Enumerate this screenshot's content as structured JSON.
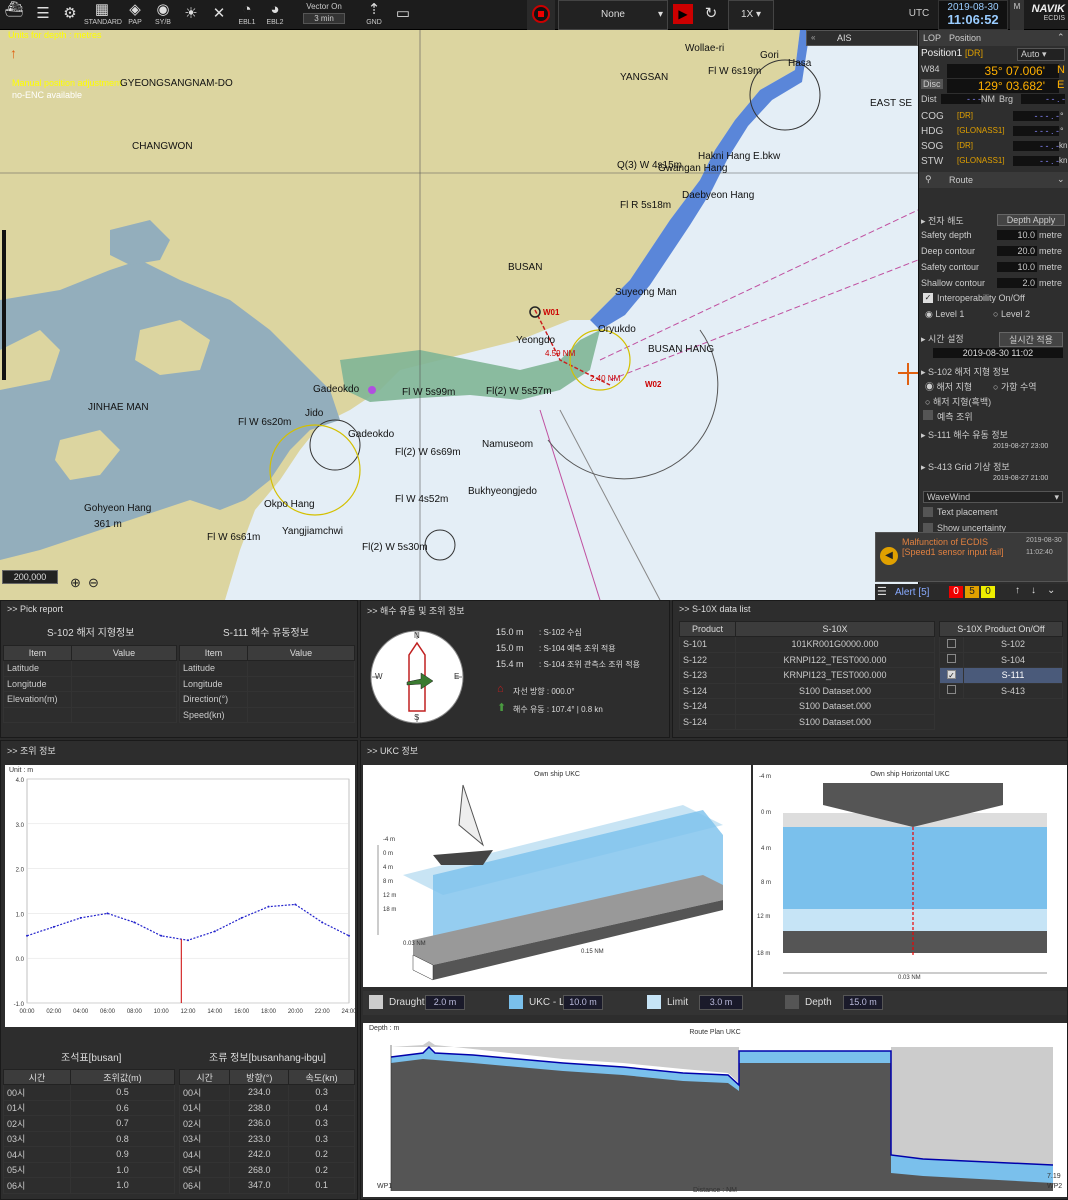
{
  "toolbar": {
    "standard": "STANDARD",
    "pap": "PAP",
    "syb": "SY/B",
    "ebl1": "EBL1",
    "ebl2": "EBL2",
    "vector_label": "Vector On",
    "vector_value": "3 min",
    "gnd": "GND",
    "none": "None",
    "speed": "1X",
    "utc": "UTC",
    "date": "2019-08-30",
    "time": "11:06:52",
    "brand": "NAVIK",
    "brand_sub": "ECDIS",
    "mode": "M"
  },
  "map": {
    "units": "Units for depth : metres",
    "manual": "Manual position adjustment",
    "noenc": "no-ENC available",
    "scale": "200,000",
    "places": {
      "gyeongnam": "GYEONGSANGNAM-DO",
      "changwon": "CHANGWON",
      "yangsan": "YANGSAN",
      "busan": "BUSAN",
      "jinhae": "JINHAE MAN",
      "busanhang": "BUSAN HANG",
      "eastsea": "EAST SE",
      "wollae": "Wollae-ri",
      "gohyeon": "Gohyeon Hang",
      "okpo": "Okpo Hang",
      "suyeong": "Suyeong Man",
      "oryukdo": "Oryukdo",
      "yeongdo": "Yeongdo",
      "gadeokdo": "Gadeokdo",
      "gadeokdo2": "Gadeokdo",
      "namuseom": "Namuseom",
      "bukhyeong": "Bukhyeongjedo",
      "yangjiam": "Yangjiamchwi",
      "daebyeon": "Daebyeon Hang",
      "gangwang": "Gwangan Hang",
      "hakni": "Hakni Hang E.bkw",
      "gori": "Gori",
      "hasa": "Hasa",
      "ttl361": "361 m",
      "jido": "Jido"
    },
    "lights": {
      "l1": "Fl W 6s19m",
      "l2": "Fl R 5s18m",
      "l3": "Q(3) W 4s15m",
      "l4": "Fl W 6s20m",
      "l5": "Fl(2) W 6s69m",
      "l6": "Fl W 4s52m",
      "l7": "Fl W 6s61m",
      "l8": "Fl(2) W 5s30m",
      "l9": "Fl(2) W 5s57m",
      "l10": "Fl W 5s99m"
    },
    "marks": {
      "w01": "W01",
      "w02": "W02",
      "sp1": "4.59 NM",
      "sp2": "2.40 NM"
    }
  },
  "right": {
    "ais": "AIS",
    "lop": "LOP",
    "position": "Position",
    "pos1": "Position1",
    "dr": "[DR]",
    "auto": "Auto",
    "w84": "W84",
    "lat": "35° 07.006'",
    "lat_h": "N",
    "disc": "Disc",
    "lon": "129° 03.682'",
    "lon_h": "E",
    "dist": "Dist",
    "nm": "NM",
    "brg": "Brg",
    "cog": "COG",
    "hdg": "HDG",
    "sog": "SOG",
    "stw": "STW",
    "cog_s": "[DR]",
    "hdg_s": "[GLONASS1]",
    "sog_s": "[DR]",
    "stw_s": "[GLONASS1]",
    "kn": "kn",
    "deg": "°",
    "route": "Route",
    "depth_title": "전자 해도",
    "depth_apply": "Depth Apply",
    "safety_depth": "Safety depth",
    "safety_depth_v": "10.0",
    "deep": "Deep contour",
    "deep_v": "20.0",
    "safety_c": "Safety contour",
    "safety_c_v": "10.0",
    "shallow": "Shallow contour",
    "shallow_v": "2.0",
    "metre": "metre",
    "interop": "Interoperability On/Off",
    "level1": "Level 1",
    "level2": "Level 2",
    "time_set": "시간 설정",
    "realtime": "실시간 적용",
    "time_val": "2019-08-30 11:02",
    "s102": "S-102 해저 지형 정보",
    "haejeo": "해저 지형",
    "gahang": "가항 수역",
    "haejeo2": "해저 지형(흑백)",
    "yecheuk": "예측 조위",
    "s111": "S-111 해수 유동 정보",
    "s111_t": "2019-08-27 23:00",
    "s413": "S-413 Grid 기상 정보",
    "s413_t": "2019-08-27 21:00",
    "wavewind": "WaveWind",
    "text_place": "Text placement",
    "show_unc": "Show uncertainty",
    "alarm_msg": "Malfunction of ECDIS [Speed1 sensor input fail]",
    "alarm_date": "2019-08-30",
    "alarm_time": "11:02:40",
    "alert": "Alert [5]",
    "a0": "0",
    "a5": "5",
    "a0b": "0"
  },
  "pick": {
    "title": ">> Pick report",
    "s102": "S-102 해저 지형정보",
    "s111": "S-111 해수 유동정보",
    "item": "Item",
    "value": "Value",
    "rows102": [
      "Latitude",
      "Longitude",
      "Elevation(m)"
    ],
    "rows111": [
      "Latitude",
      "Longitude",
      "Direction(°)",
      "Speed(kn)"
    ]
  },
  "current": {
    "title": ">> 해수 유동 및 조위 정보",
    "r1v": "15.0 m",
    "r1t": ": S-102 수심",
    "r2v": "15.0 m",
    "r2t": ": S-104 예측 조위 적용",
    "r3v": "15.4 m",
    "r3t": ": S-104 조위 관측소 조위 적용",
    "own": "자선 방향 : 000.0°",
    "flow": "해수 유동 : 107.4° | 0.8 kn",
    "n": "N",
    "s": "S",
    "e": "E",
    "w": "W"
  },
  "s10x": {
    "title": ">> S-10X data list",
    "h_product": "Product",
    "h_s10x": "S-10X",
    "h_onoff": "S-10X Product On/Off",
    "rows": [
      [
        "S-101",
        "101KR001G0000.000"
      ],
      [
        "S-122",
        "KRNPI122_TEST000.000"
      ],
      [
        "S-123",
        "KRNPI123_TEST000.000"
      ],
      [
        "S-124",
        "S100 Dataset.000"
      ],
      [
        "S-124",
        "S100 Dataset.000"
      ],
      [
        "S-124",
        "S100 Dataset.000"
      ]
    ],
    "onoff": [
      [
        "S-102",
        false
      ],
      [
        "S-104",
        false
      ],
      [
        "S-111",
        true
      ],
      [
        "S-413",
        false
      ]
    ]
  },
  "tide": {
    "title": ">> 조위 정보",
    "unit": "Unit : m",
    "table_title": "조석표[busan]",
    "col_time": "시간",
    "col_val": "조위값(m)",
    "rows": [
      [
        "00시",
        "0.5"
      ],
      [
        "01시",
        "0.6"
      ],
      [
        "02시",
        "0.7"
      ],
      [
        "03시",
        "0.8"
      ],
      [
        "04시",
        "0.9"
      ],
      [
        "05시",
        "1.0"
      ],
      [
        "06시",
        "1.0"
      ]
    ]
  },
  "current_table": {
    "title": "조류 정보[busanhang-ibgu]",
    "col_time": "시간",
    "col_dir": "방향(°)",
    "col_spd": "속도(kn)",
    "rows": [
      [
        "00시",
        "234.0",
        "0.3"
      ],
      [
        "01시",
        "238.0",
        "0.4"
      ],
      [
        "02시",
        "236.0",
        "0.3"
      ],
      [
        "03시",
        "233.0",
        "0.3"
      ],
      [
        "04시",
        "242.0",
        "0.2"
      ],
      [
        "05시",
        "268.0",
        "0.2"
      ],
      [
        "06시",
        "347.0",
        "0.1"
      ]
    ]
  },
  "ukc": {
    "title": ">> UKC 정보",
    "own": "Own ship UKC",
    "horiz": "Own ship Horizontal UKC",
    "d015": "0.15 NM",
    "d003": "0.03 NM",
    "d003b": "0.03 NM",
    "draught": "Draught",
    "draught_v": "2.0 m",
    "ukc_l": "UKC - L",
    "ukc_l_v": "10.0 m",
    "limit": "Limit",
    "limit_v": "3.0 m",
    "depth": "Depth",
    "depth_v": "15.0 m",
    "route_title": "Route Plan UKC",
    "depth_m": "Depth : m",
    "dist_nm": "Distance : NM",
    "wp1": "WP1",
    "wp2": "WP2",
    "end": "7.19",
    "ticks_left": [
      "-4 m",
      "0 m",
      "4 m",
      "8 m",
      "12 m",
      "18 m"
    ],
    "ticks_right": [
      "-4 m",
      "0 m",
      "4 m",
      "8 m",
      "12 m",
      "18 m"
    ]
  },
  "chart_data": [
    {
      "type": "line",
      "title": "",
      "xlabel": "",
      "ylabel": "Unit : m",
      "x": [
        "00:00",
        "02:00",
        "04:00",
        "06:00",
        "08:00",
        "10:00",
        "12:00",
        "14:00",
        "16:00",
        "18:00",
        "20:00",
        "22:00",
        "24:00"
      ],
      "series": [
        {
          "values": [
            0.5,
            0.7,
            0.9,
            1.0,
            0.8,
            0.5,
            0.4,
            0.6,
            0.9,
            1.15,
            1.2,
            0.8,
            0.5
          ]
        }
      ],
      "ylim": [
        -1.0,
        4.0
      ],
      "yticks": [
        "4.0",
        "3.0",
        "2.0",
        "1.0",
        "0.0",
        "-1.0"
      ],
      "marker_x": "11:30"
    }
  ]
}
